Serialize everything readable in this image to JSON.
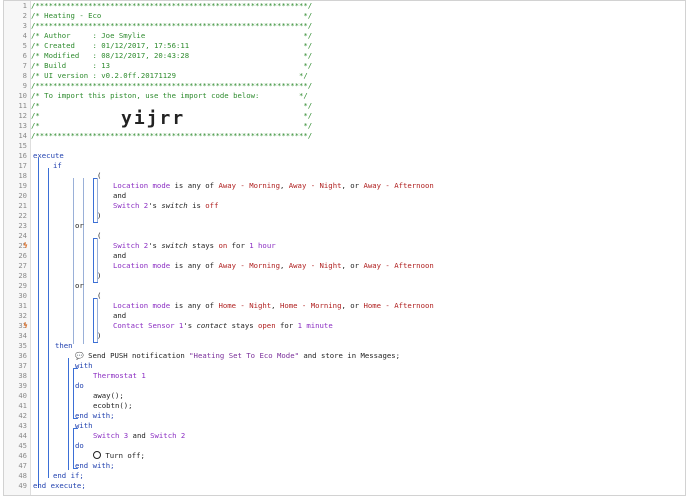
{
  "header": {
    "stars_line": "/**************************************************************/",
    "title_line": "/* Heating - Eco                                              */",
    "author_line": "/* Author     : Joe Smylie                                    */",
    "created_line": "/* Created    : 01/12/2017, 17:56:11                          */",
    "modified_line": "/* Modified   : 08/12/2017, 20:43:28                          */",
    "build_line": "/* Build      : 13                                            */",
    "ui_line": "/* UI version : v0.2.0ff.20171129                            */",
    "import_line": "/* To import this piston, use the import code below:         */",
    "blank_line_a": "/*                                                            */",
    "blank_line_b": "/*                                                            */",
    "blank_line_c": "/*                                                            */",
    "import_code": "yijrr"
  },
  "code": {
    "execute": "execute",
    "if": "if",
    "open_paren": "(",
    "close_paren": ")",
    "and": "and",
    "or": "or",
    "then": "then",
    "with": "with",
    "do": "do",
    "end_with": "end with;",
    "end_if": "end if;",
    "end_execute": "end execute;",
    "location_mode": "Location mode",
    "is_any_of": " is any of ",
    "comma": ", ",
    "or_text": ", or ",
    "mode_away_morning": "Away - Morning",
    "mode_away_night": "Away - Night",
    "mode_away_afternoon": "Away - Afternoon",
    "mode_home_night": "Home - Night",
    "mode_home_morning": "Home - Morning",
    "mode_home_afternoon": "Home - Afternoon",
    "switch2": "Switch 2",
    "possessive": "'s ",
    "switch_attr": "switch",
    "is": " is ",
    "off": "off",
    "stays": " stays ",
    "on": "on",
    "for": " for ",
    "one": "1",
    "hour": " hour",
    "minute": " minute",
    "contact_sensor": "Contact Sensor 1",
    "contact_attr": "contact",
    "open": "open",
    "send_push": " Send PUSH notification ",
    "push_message": "\"Heating Set To Eco Mode\"",
    "store_text": " and store in Messages;",
    "thermostat": "Thermostat 1",
    "away_call": "away();",
    "ecobtn_call": "ecobtn();",
    "switch3": "Switch 3",
    "and_text": " and ",
    "turn_off": " Turn off;"
  },
  "line_numbers": [
    "1",
    "2",
    "3",
    "4",
    "5",
    "6",
    "7",
    "8",
    "9",
    "10",
    "11",
    "12",
    "13",
    "14",
    "15",
    "16",
    "17",
    "18",
    "19",
    "20",
    "21",
    "22",
    "23",
    "24",
    "25",
    "26",
    "27",
    "28",
    "29",
    "30",
    "31",
    "32",
    "33",
    "34",
    "35",
    "36",
    "37",
    "38",
    "39",
    "40",
    "41",
    "42",
    "43",
    "44",
    "45",
    "46",
    "47",
    "48",
    "49"
  ],
  "trigger_marker": "ϟ"
}
